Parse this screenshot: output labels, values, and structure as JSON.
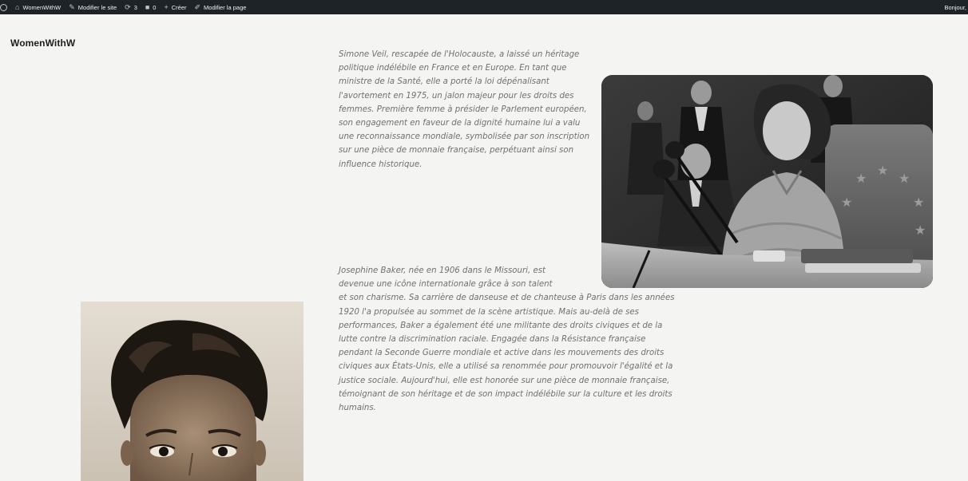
{
  "adminbar": {
    "items": [
      {
        "icon": "home-icon",
        "label": "WomenWithW"
      },
      {
        "icon": "paintbrush-icon",
        "label": "Modifier le site"
      },
      {
        "icon": "updates-icon",
        "label": "3"
      },
      {
        "icon": "comment-icon",
        "label": "0"
      },
      {
        "icon": "plus-icon",
        "label": "Créer"
      },
      {
        "icon": "pencil-icon",
        "label": "Modifier la page"
      }
    ],
    "greeting": "Bonjour, "
  },
  "site": {
    "title": "WomenWithW"
  },
  "bios": {
    "veil": "Simone Veil, rescapée de l'Holocauste, a laissé un héritage politique indélébile en France et en Europe. En tant que ministre de la Santé, elle a porté la loi dépénalisant l'avortement en 1975, un jalon majeur pour les droits des femmes. Première femme à présider le Parlement européen, son engagement en faveur de la dignité humaine lui a valu une reconnaissance mondiale, symbolisée par son inscription sur une pièce de monnaie française, perpétuant ainsi son influence historique.",
    "baker_lead": "Josephine Baker, née en 1906 dans le Missouri, est devenue une icône internationale grâce à son talent",
    "baker_rest": "et son charisme. Sa carrière de danseuse et de chanteuse à Paris dans les années 1920 l'a propulsée au sommet de la scène artistique. Mais au-delà de ses performances, Baker a également été une militante des droits civiques et de la lutte contre la discrimination raciale. Engagée dans la Résistance française pendant la Seconde Guerre mondiale et active dans les mouvements des droits civiques aux États-Unis, elle a utilisé sa renommée pour promouvoir l'égalité et la justice sociale. Aujourd'hui, elle est honorée sur une pièce de monnaie française, témoignant de son héritage et de son impact indélébile sur la culture et les droits humains."
  },
  "colors": {
    "adminbar_bg": "#1d2327",
    "page_bg": "#f4f4f2",
    "body_text": "#707070",
    "title_text": "#1e1e1e"
  }
}
